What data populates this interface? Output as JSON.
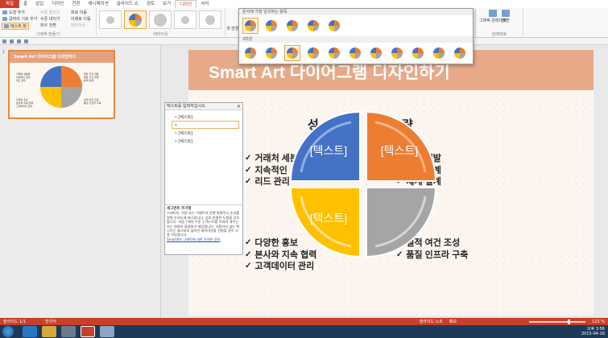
{
  "ribbon_tabs": [
    "파일",
    "홈",
    "삽입",
    "디자인",
    "전환",
    "애니메이션",
    "슬라이드 쇼",
    "검토",
    "보기",
    "디자인",
    "서식"
  ],
  "ribbon": {
    "create_graphic": {
      "add_shape": "도형 추가",
      "add_bullet": "글머리 기호 추가",
      "text_pane": "텍스트 창",
      "promote": "수준 올리기",
      "demote": "수준 내리기",
      "right_to_left": "좌우 전환",
      "move_up": "위로 이동",
      "move_down": "아래로 이동",
      "layout_btn": "레이아웃",
      "group_label": "그래픽 만들기"
    },
    "layouts_label": "레이아웃",
    "change_colors": "색 변경",
    "reset": {
      "reset_graphic": "그래픽 원래대로",
      "convert": "변환",
      "group_label": "원래대로"
    }
  },
  "style_gallery": {
    "section1": "문서에 가장 일치하는 항목",
    "section2": "3차원",
    "colors": {
      "blue": "#4472c4",
      "orange": "#ed7d31",
      "gray": "#a5a5a5",
      "gold": "#ffc000",
      "selected": "#e8a53c"
    }
  },
  "thumbnail": {
    "slide_number": "1",
    "title": "Smart Art 다이어그램 디자인하기",
    "left_text": [
      "거래처 세분화",
      "지속적인 관리",
      "리드 관리"
    ],
    "right_text": [
      "현장 조직 개발",
      "목표 수요 연계",
      "체계 설계"
    ],
    "bottom_left": [
      "다양한 홍보",
      "본사와 지속 협력",
      "고객데이터 관리"
    ],
    "bottom_right": [
      "실적 여건 조성",
      "품질 인프라 구축"
    ]
  },
  "slide": {
    "title": "Smart Art 다이어그램 디자인하기",
    "heading_left": "성",
    "heading_right": "략",
    "left_bullets": [
      "거래처 세분",
      "지속적인",
      "리드 관리"
    ],
    "right_bullets": [
      "조직 개발",
      "수요 연계",
      "체계 설계"
    ],
    "bottom_left_bullets": [
      "다양한 홍보",
      "본사와 지속 협력",
      "고객데이터 관리"
    ],
    "bottom_right_bullets": [
      "실적 여건 조성",
      "품질 인프라 구축"
    ],
    "diagram_labels": [
      "[텍스트]",
      "[텍스트]",
      "[텍스트]"
    ],
    "check_glyph": "✓",
    "colors": {
      "band": "#e7aa88",
      "blue": "#4472c4",
      "orange": "#ed7d31",
      "gray": "#a5a5a5",
      "gold": "#ffc000"
    }
  },
  "text_pane": {
    "title": "텍스트를 입력하십시오.",
    "close": "×",
    "items": [
      "[텍스트]",
      "",
      "[텍스트]",
      "[텍스트]"
    ],
    "info_title": "세그먼트 주기형",
    "info_body": "스테이지, 작업 또는 이벤트의 진행 방향이나 순서를 원형 순서도에 표시합니다. 상호 연결된 도형을 강조합니다. 처음 7개의 수준 1 텍스트를 가지며 개수는 또는 원형의 화살표가 해당합니다. 사용하지 않는 텍스트는 표시되지 않지만 레이아웃을 전환할 경우 사용 가능합니다.",
    "info_link": "SmartArt 그래픽에 대한 자세한 정보"
  },
  "status": {
    "slide": "슬라이드 1/1",
    "language": "한국어",
    "notes": "슬라이드 노트",
    "comments": "메모",
    "zoom": "115 %"
  },
  "taskbar": {
    "time": "오후 3:56",
    "date": "2015-04-16"
  }
}
